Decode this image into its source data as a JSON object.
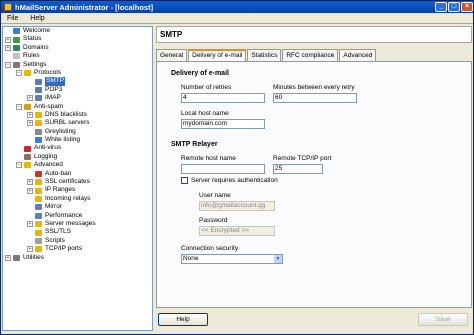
{
  "window": {
    "title": "hMailServer Administrator - [localhost]"
  },
  "menu": [
    "File",
    "Help"
  ],
  "tree": [
    {
      "label": "Welcome",
      "level": 0,
      "expander": "",
      "icon_color": "#3a7bd5"
    },
    {
      "label": "Status",
      "level": 0,
      "expander": "+",
      "icon_color": "#3a9b3a"
    },
    {
      "label": "Domains",
      "level": 0,
      "expander": "+",
      "icon_color": "#2e8b57"
    },
    {
      "label": "Rules",
      "level": 0,
      "expander": "",
      "icon_color": "#c0c0c0"
    },
    {
      "label": "Settings",
      "level": 0,
      "expander": "-",
      "icon_color": "#7a7a7a"
    },
    {
      "label": "Protocols",
      "level": 1,
      "expander": "-",
      "icon_color": "#e6b800"
    },
    {
      "label": "SMTP",
      "level": 2,
      "expander": "",
      "icon_color": "#5a7fb0",
      "selected": true
    },
    {
      "label": "POP3",
      "level": 2,
      "expander": "",
      "icon_color": "#5a7fb0"
    },
    {
      "label": "IMAP",
      "level": 2,
      "expander": "+",
      "icon_color": "#5a7fb0"
    },
    {
      "label": "Anti-spam",
      "level": 1,
      "expander": "-",
      "icon_color": "#d4a017"
    },
    {
      "label": "DNS blacklists",
      "level": 2,
      "expander": "+",
      "icon_color": "#e6b800"
    },
    {
      "label": "SURBL servers",
      "level": 2,
      "expander": "+",
      "icon_color": "#e6b800"
    },
    {
      "label": "Greylisting",
      "level": 2,
      "expander": "",
      "icon_color": "#888888"
    },
    {
      "label": "White listing",
      "level": 2,
      "expander": "",
      "icon_color": "#3a7bd5"
    },
    {
      "label": "Anti-virus",
      "level": 1,
      "expander": "",
      "icon_color": "#c62828"
    },
    {
      "label": "Logging",
      "level": 1,
      "expander": "",
      "icon_color": "#8d6e63"
    },
    {
      "label": "Advanced",
      "level": 1,
      "expander": "-",
      "icon_color": "#e6b800"
    },
    {
      "label": "Auto-ban",
      "level": 2,
      "expander": "",
      "icon_color": "#d32f2f"
    },
    {
      "label": "SSL certificates",
      "level": 2,
      "expander": "+",
      "icon_color": "#e6b800"
    },
    {
      "label": "IP Ranges",
      "level": 2,
      "expander": "+",
      "icon_color": "#e6b800"
    },
    {
      "label": "Incoming relays",
      "level": 2,
      "expander": "",
      "icon_color": "#e6b800"
    },
    {
      "label": "Mirror",
      "level": 2,
      "expander": "",
      "icon_color": "#5a7fb0"
    },
    {
      "label": "Performance",
      "level": 2,
      "expander": "",
      "icon_color": "#5a7fb0"
    },
    {
      "label": "Server messages",
      "level": 2,
      "expander": "+",
      "icon_color": "#e6b800"
    },
    {
      "label": "SSL/TLS",
      "level": 2,
      "expander": "",
      "icon_color": "#e6b800"
    },
    {
      "label": "Scripts",
      "level": 2,
      "expander": "",
      "icon_color": "#9e9e9e"
    },
    {
      "label": "TCP/IP ports",
      "level": 2,
      "expander": "+",
      "icon_color": "#e6b800"
    },
    {
      "label": "Utilities",
      "level": 0,
      "expander": "+",
      "icon_color": "#7a7a7a"
    }
  ],
  "panel": {
    "header": "SMTP",
    "tabs": [
      "General",
      "Delivery of e-mail",
      "Statistics",
      "RFC compliance",
      "Advanced"
    ],
    "active_tab": 1,
    "delivery": {
      "section_title": "Delivery of e-mail",
      "retries_label": "Number of retries",
      "retries_value": "4",
      "minutes_label": "Minutes between every retry",
      "minutes_value": "60",
      "hostname_label": "Local host name",
      "hostname_value": "mydomain.com"
    },
    "relayer": {
      "section_title": "SMTP Relayer",
      "host_label": "Remote host name",
      "host_value": "",
      "port_label": "Remote TCP/IP port",
      "port_value": "25",
      "auth_label": "Server requires authentication",
      "auth_checked": false,
      "user_label": "User name",
      "user_value": "info@gmailaccount.gg",
      "password_label": "Password",
      "password_value": "<< Encrypted >>",
      "security_label": "Connection security",
      "security_value": "None"
    },
    "help_label": "Help",
    "save_label": "Save"
  }
}
